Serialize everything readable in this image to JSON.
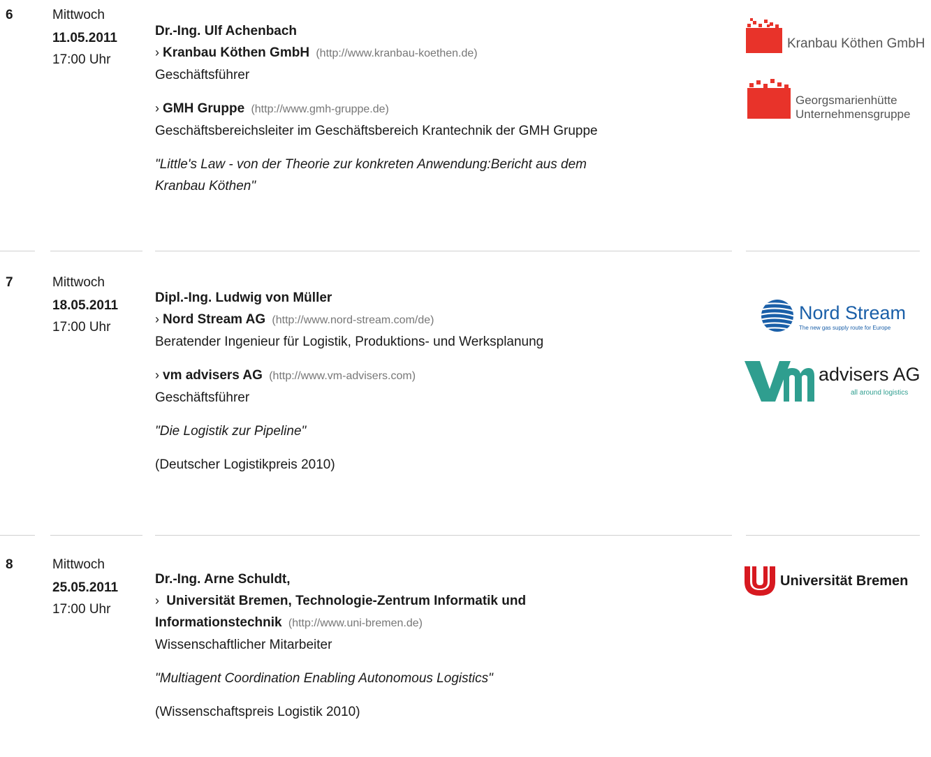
{
  "events": [
    {
      "number": "6",
      "weekday": "Mittwoch",
      "date": "11.05.2011",
      "time": "17:00 Uhr",
      "speaker": "Dr.-Ing. Ulf Achenbach",
      "orgs": [
        {
          "name": "Kranbau Köthen GmbH",
          "url": "(http://www.kranbau-koethen.de)",
          "role": "Geschäftsführer"
        },
        {
          "name": "GMH Gruppe",
          "url": "(http://www.gmh-gruppe.de)",
          "role": "Geschäftsbereichsleiter im Geschäftsbereich Krantechnik der GMH Gruppe"
        }
      ],
      "topic_line1": "\"Little's Law - von der Theorie zur konkreten Anwendung:Bericht aus dem",
      "topic_line2": "Kranbau Köthen\"",
      "logos": [
        {
          "text": "Kranbau Köthen GmbH",
          "color": "#e8332a"
        },
        {
          "line1": "Georgsmarienhütte",
          "line2": "Unternehmensgruppe",
          "color": "#e8332a"
        }
      ]
    },
    {
      "number": "7",
      "weekday": "Mittwoch",
      "date": "18.05.2011",
      "time": "17:00 Uhr",
      "speaker": "Dipl.-Ing. Ludwig von Müller",
      "orgs": [
        {
          "name": "Nord Stream AG",
          "url": "(http://www.nord-stream.com/de)",
          "role": "Beratender Ingenieur für Logistik, Produktions- und Werksplanung"
        },
        {
          "name": "vm advisers AG",
          "url": "(http://www.vm-advisers.com)",
          "role": "Geschäftsführer"
        }
      ],
      "topic": "\"Die Logistik zur Pipeline\"",
      "note": "(Deutscher Logistikpreis 2010)",
      "logos": [
        {
          "text": "Nord Stream",
          "tagline": "The new gas supply route for Europe",
          "color": "#1a5fa8"
        },
        {
          "text": "advisers AG",
          "tagline": "all around logistics",
          "color": "#2f9e8f"
        }
      ]
    },
    {
      "number": "8",
      "weekday": "Mittwoch",
      "date": "25.05.2011",
      "time": "17:00 Uhr",
      "speaker": "Dr.-Ing. Arne Schuldt,",
      "org_line1": "Universität Bremen, Technologie-Zentrum Informatik und",
      "org_line2": "Informationstechnik",
      "url": "(http://www.uni-bremen.de)",
      "role": "Wissenschaftlicher Mitarbeiter",
      "topic": "\"Multiagent Coordination Enabling Autonomous Logistics\"",
      "note": "(Wissenschaftspreis Logistik 2010)",
      "logos": [
        {
          "text": "Universität Bremen",
          "color": "#d71920"
        }
      ]
    }
  ]
}
